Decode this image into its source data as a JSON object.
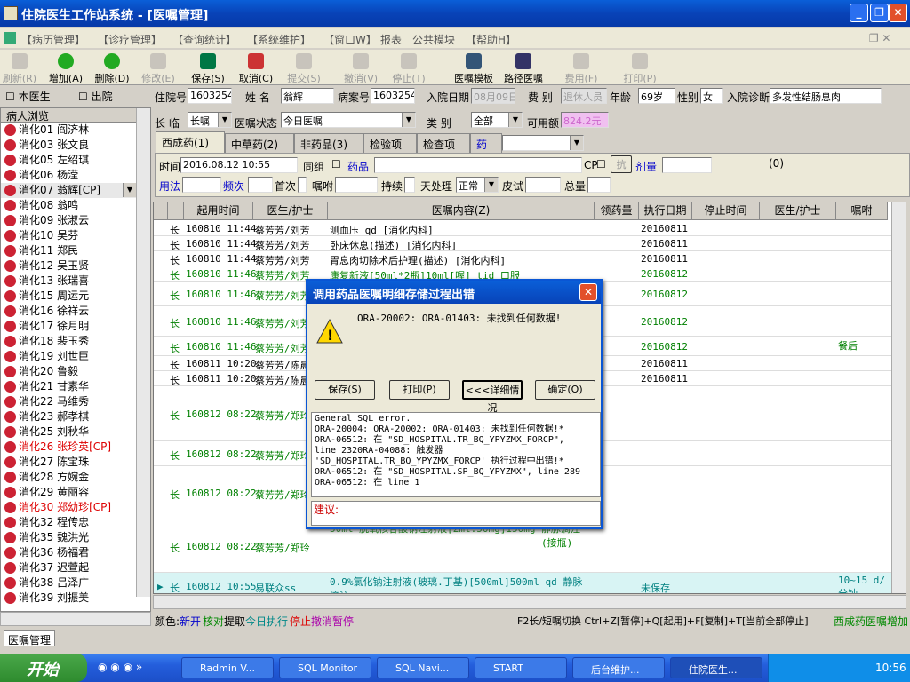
{
  "window": {
    "title": "住院医生工作站系统 - [医嘱管理]"
  },
  "menu": [
    "【病历管理】",
    "【诊疗管理】",
    "【查询统计】",
    "【系统维护】",
    "【窗口W】",
    "报表",
    "公共模块",
    "【帮助H】"
  ],
  "toolbar": [
    {
      "label": "刷新(R)",
      "enabled": false
    },
    {
      "label": "增加(A)",
      "enabled": true
    },
    {
      "label": "删除(D)",
      "enabled": true
    },
    {
      "label": "修改(E)",
      "enabled": false
    },
    {
      "label": "保存(S)",
      "enabled": true
    },
    {
      "label": "取消(C)",
      "enabled": true
    },
    {
      "label": "提交(S)",
      "enabled": false
    },
    {
      "label": "撤消(V)",
      "enabled": false
    },
    {
      "label": "停止(T)",
      "enabled": false
    },
    {
      "label": "医嘱模板",
      "enabled": true
    },
    {
      "label": "路径医嘱",
      "enabled": true
    },
    {
      "label": "费用(F)",
      "enabled": false
    },
    {
      "label": "打印(P)",
      "enabled": false
    }
  ],
  "filters": {
    "own_doctor": "本医生",
    "discharged": "出院"
  },
  "patient": {
    "inpatient_no_label": "住院号",
    "inpatient_no": "1603254",
    "name_label": "姓  名",
    "name": "翁辉",
    "record_no_label": "病案号",
    "record_no": "1603254",
    "admit_date_label": "入院日期",
    "admit_date": "08月09日",
    "fee_type_label": "费  别",
    "fee_type": "退休人员",
    "age_label": "年龄",
    "age": "69岁",
    "sex_label": "性别",
    "sex": "女",
    "diagnosis_label": "入院诊断",
    "diagnosis": "多发性结肠息肉"
  },
  "order_bar": {
    "term_label": "长  临",
    "term": "长嘱",
    "status_label": "医嘱状态",
    "status": "今日医嘱",
    "type_label": "类      别",
    "type": "全部",
    "balance_label": "可用额",
    "balance": "824.2元"
  },
  "tabs": [
    "西成药(1)",
    "中草药(2)",
    "非药品(3)",
    "检验项目",
    "检查项目",
    "药房"
  ],
  "entry": {
    "time_label": "时间",
    "time": "2016.08.12 10:55",
    "same_group": "同组",
    "drug": "药品",
    "cp": "CP",
    "anti": "抗",
    "dose": "剂量",
    "counter": "(0)",
    "usage": "用法",
    "frequency": "频次",
    "first_times": "首次",
    "order_note": "嘱咐",
    "duration": "持续",
    "day_process": "天处理",
    "process_value": "正常",
    "skin_test": "皮试",
    "total": "总量"
  },
  "patient_list": {
    "header": "病人浏览",
    "items": [
      {
        "text": "消化01 阎济林",
        "red": false
      },
      {
        "text": "消化03 张文良",
        "red": false
      },
      {
        "text": "消化05 左绍琪",
        "red": false
      },
      {
        "text": "消化06 杨滢",
        "red": false
      },
      {
        "text": "消化07 翁辉[CP]",
        "red": false,
        "selected": true
      },
      {
        "text": "消化08 翁鸣",
        "red": false
      },
      {
        "text": "消化09 张淑云",
        "red": false
      },
      {
        "text": "消化10 吴芬",
        "red": false
      },
      {
        "text": "消化11 郑民",
        "red": false
      },
      {
        "text": "消化12 吴玉贤",
        "red": false
      },
      {
        "text": "消化13 张瑞喜",
        "red": false
      },
      {
        "text": "消化15 周运元",
        "red": false
      },
      {
        "text": "消化16 徐祥云",
        "red": false
      },
      {
        "text": "消化17 徐月明",
        "red": false
      },
      {
        "text": "消化18 裴玉秀",
        "red": false
      },
      {
        "text": "消化19 刘世臣",
        "red": false
      },
      {
        "text": "消化20 鲁毅",
        "red": false
      },
      {
        "text": "消化21 甘素华",
        "red": false
      },
      {
        "text": "消化22 马维秀",
        "red": false
      },
      {
        "text": "消化23 郝孝棋",
        "red": false
      },
      {
        "text": "消化25 刘秋华",
        "red": false
      },
      {
        "text": "消化26 张珍英[CP]",
        "red": true
      },
      {
        "text": "消化27 陈宝珠",
        "red": false
      },
      {
        "text": "消化28 方婉金",
        "red": false
      },
      {
        "text": "消化29 黄丽容",
        "red": false
      },
      {
        "text": "消化30 郑幼珍[CP]",
        "red": true
      },
      {
        "text": "消化32 程传忠",
        "red": false
      },
      {
        "text": "消化35 魏洪光",
        "red": false
      },
      {
        "text": "消化36 杨福君",
        "red": false
      },
      {
        "text": "消化37 迟萱起",
        "red": false
      },
      {
        "text": "消化38 吕泽广",
        "red": false
      },
      {
        "text": "消化39 刘振美",
        "red": false
      }
    ]
  },
  "grid": {
    "columns": [
      "起用时间",
      "医生/护士",
      "医嘱内容(Z)",
      "领药量",
      "执行日期",
      "停止时间",
      "医生/护士",
      "嘱咐"
    ],
    "rows": [
      {
        "t": "长",
        "start": "160810 11:44",
        "doc": "蔡芳芳/刘芳",
        "content": "测血压 qd  [消化内科]",
        "exec": "20160811",
        "note": "",
        "style": ""
      },
      {
        "t": "长",
        "start": "160810 11:44",
        "doc": "蔡芳芳/刘芳",
        "content": "卧床休息(描述)  [消化内科]",
        "exec": "20160811",
        "note": "",
        "style": ""
      },
      {
        "t": "长",
        "start": "160810 11:44",
        "doc": "蔡芳芳/刘芳",
        "content": "胃息肉切除术后护理(描述)  [消化内科]",
        "exec": "20160811",
        "note": "",
        "style": ""
      },
      {
        "t": "长",
        "start": "160810 11:46",
        "doc": "蔡芳芳/刘芳",
        "content": "康复新液[50ml*2瓶]10ml[喔] tid 口服",
        "exec": "20160812",
        "note": "",
        "style": "green"
      },
      {
        "t": "长",
        "start": "160810 11:46",
        "doc": "蔡芳芳/刘芳",
        "content": "",
        "exec": "20160812",
        "note": "",
        "style": "green"
      },
      {
        "t": "长",
        "start": "160810 11:46",
        "doc": "蔡芳芳/刘芳",
        "content": "",
        "exec": "20160812",
        "note": "",
        "style": "green"
      },
      {
        "t": "长",
        "start": "160810 11:46",
        "doc": "蔡芳芳/刘芳",
        "content": "",
        "exec": "20160812",
        "note": "餐后",
        "style": "green"
      },
      {
        "t": "长",
        "start": "160811 10:20",
        "doc": "蔡芳芳/陈晨",
        "content": "",
        "exec": "20160811",
        "note": "",
        "style": ""
      },
      {
        "t": "长",
        "start": "160811 10:20",
        "doc": "蔡芳芳/陈晨",
        "content": "",
        "exec": "20160811",
        "note": "",
        "style": ""
      },
      {
        "t": "长",
        "start": "160812 08:22",
        "doc": "蔡芳芳/郑玲",
        "content": "",
        "exec": "",
        "note": "",
        "style": "green"
      },
      {
        "t": "长",
        "start": "160812 08:22",
        "doc": "蔡芳芳/郑玲",
        "content": "",
        "exec": "",
        "note": "",
        "style": "green"
      },
      {
        "t": "长",
        "start": "160812 08:22",
        "doc": "蔡芳芳/郑玲",
        "content": "",
        "exec": "",
        "note": "",
        "style": "green"
      },
      {
        "t": "长",
        "start": "160812 08:22",
        "doc": "蔡芳芳/郑玲",
        "content": "50ml 脱氧核苷酸钠注射液[2ml:50mg]150mg",
        "exec": "",
        "note": "",
        "style": "green",
        "extra": "静脉滴注(接瓶)"
      },
      {
        "t": "长",
        "start": "160812 10:55",
        "doc": "易联众ss",
        "content": "0.9%氯化钠注射液(玻璃.丁基)[500ml]500ml qd 静脉滴注",
        "exec": "未保存",
        "note": "10~15 d/分钟",
        "style": "cyan"
      }
    ]
  },
  "dialog": {
    "title": "调用药品医嘱明细存储过程出错",
    "message": "ORA-20002: ORA-01403: 未找到任何数据!",
    "buttons": [
      "保存(S)",
      "打印(P)",
      "<<<详细情况",
      "确定(O)"
    ],
    "detail": [
      "General SQL error.",
      "ORA-20004: ORA-20002: ORA-01403: 未找到任何数据!*",
      "ORA-06512: 在 \"SD_HOSPITAL.TR_BQ_YPYZMX_FORCP\",",
      "line 2320RA-04088: 触发器",
      "'SD_HOSPITAL.TR_BQ_YPYZMX_FORCP' 执行过程中出错!*",
      "ORA-06512: 在 \"SD_HOSPITAL.SP_BQ_YPYZMX\", line 289",
      "ORA-06512: 在 line 1"
    ],
    "suggest_label": "建议:"
  },
  "status": {
    "color_prefix": "颜色:",
    "new": "新开",
    "verify": "核对",
    "fetch": "提取",
    "today": "今日执行",
    "stop": "停止",
    "cancel": "撤消",
    "pause": "暂停",
    "hint": "F2长/短嘱切换 Ctrl+Z[暂停]+Q[起用]+F[复制]+T[当前全部停止]",
    "right": "西成药医嘱增加"
  },
  "mdi_tab": "医嘱管理",
  "taskbar": {
    "start": "开始",
    "tasks": [
      "Radmin V...",
      "SQL Monitor",
      "SQL Navi...",
      "START",
      "后台维护...",
      "住院医生..."
    ],
    "clock": "10:56"
  }
}
